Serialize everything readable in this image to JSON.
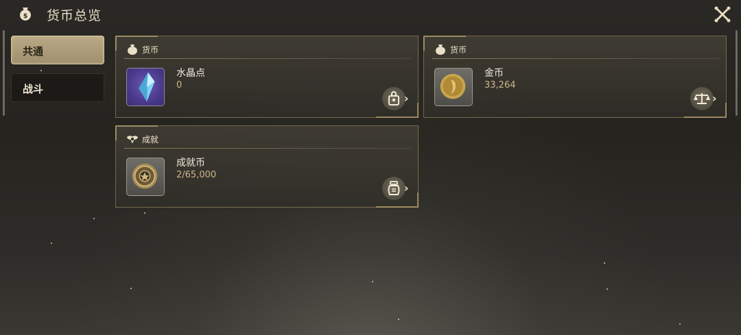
{
  "header": {
    "title": "货币总览",
    "logo_icon": "money-bag-icon",
    "close_icon": "close-icon"
  },
  "sidebar": {
    "tabs": [
      {
        "label": "共通",
        "active": true
      },
      {
        "label": "战斗",
        "active": false
      }
    ]
  },
  "cards": [
    {
      "category": "货币",
      "category_icon": "money-bag-icon",
      "name": "水晶点",
      "value": "0",
      "item_icon": "crystal-icon",
      "action_icon": "shop-bag-icon"
    },
    {
      "category": "货币",
      "category_icon": "money-bag-icon",
      "name": "金币",
      "value": "33,264",
      "item_icon": "gold-coin-icon",
      "action_icon": "scale-icon"
    },
    {
      "category": "成就",
      "category_icon": "achievement-icon",
      "name": "成就币",
      "value": "2/65,000",
      "item_icon": "achievement-coin-icon",
      "action_icon": "pouch-icon"
    }
  ],
  "colors": {
    "accent_gold": "#d8c08a",
    "tab_active": "#b9a987",
    "crystal_tile": "#4a3a8c"
  }
}
